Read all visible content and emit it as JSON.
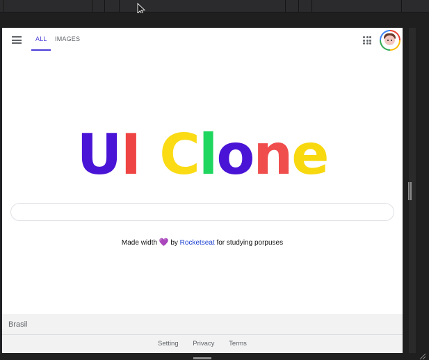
{
  "header": {
    "tabs": [
      {
        "label": "ALL",
        "active": true
      },
      {
        "label": "IMAGES",
        "active": false
      }
    ]
  },
  "logo": {
    "letters": [
      {
        "char": "U",
        "color": "#4a14d6"
      },
      {
        "char": "I",
        "color": "#ef4444"
      },
      {
        "char": " ",
        "color": "#ffffff"
      },
      {
        "char": "C",
        "color": "#fadb14"
      },
      {
        "char": "l",
        "color": "#1fd65f"
      },
      {
        "char": "o",
        "color": "#4a14d6"
      },
      {
        "char": "n",
        "color": "#f04d4d"
      },
      {
        "char": "e",
        "color": "#f8d80f"
      }
    ]
  },
  "search": {
    "placeholder": "",
    "value": ""
  },
  "made_with": {
    "prefix": "Made width",
    "heart": "💜",
    "by": "by",
    "link": "Rocketseat",
    "suffix": "for studying porpuses"
  },
  "footer": {
    "country": "Brasil",
    "links": [
      "Setting",
      "Privacy",
      "Terms"
    ]
  },
  "colors": {
    "accent": "#4a3bd9",
    "link": "#1a3fd1"
  }
}
